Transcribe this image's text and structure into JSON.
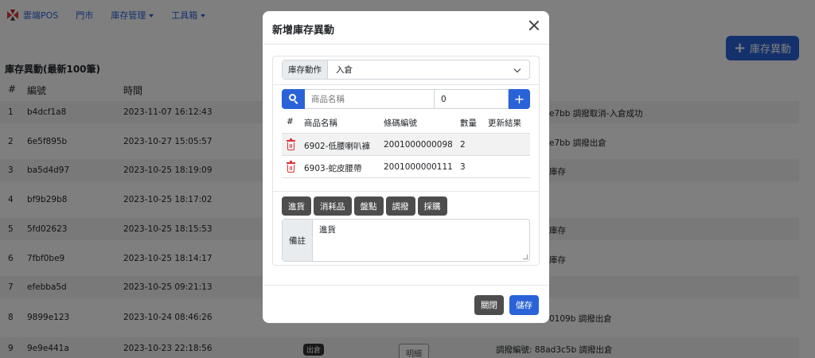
{
  "nav": {
    "brand": "雲端POS",
    "links": [
      "門市",
      "庫存管理",
      "工具箱"
    ]
  },
  "add_button_label": "庫存異動",
  "page_title": "庫存異動(最新100筆)",
  "table": {
    "headers": [
      "#",
      "編號",
      "時間"
    ],
    "rows": [
      {
        "num": "1",
        "id": "b4dcf1a8",
        "time": "2023-11-07 16:12:43",
        "note": "e7bb 調撥取消-入倉成功"
      },
      {
        "num": "2",
        "id": "6e5f895b",
        "time": "2023-10-27 15:05:57",
        "note": "e7bb 調撥出倉"
      },
      {
        "num": "3",
        "id": "ba5d4d97",
        "time": "2023-10-25 18:19:09",
        "note": "庫存"
      },
      {
        "num": "4",
        "id": "bf9b29b8",
        "time": "2023-10-25 18:17:02",
        "note": ""
      },
      {
        "num": "5",
        "id": "5fd02623",
        "time": "2023-10-25 18:15:53",
        "note": "庫存"
      },
      {
        "num": "6",
        "id": "7fbf0be9",
        "time": "2023-10-25 18:14:17",
        "note": "庫存"
      },
      {
        "num": "7",
        "id": "efebba5d",
        "time": "2023-10-25 09:21:13",
        "note": ""
      },
      {
        "num": "8",
        "id": "9899e123",
        "time": "2023-10-24 08:46:26",
        "note": "0109b 調撥出倉"
      },
      {
        "num": "9",
        "id": "9e9e441a",
        "time": "2023-10-23 22:18:56",
        "badge": "出倉",
        "detail": "明細",
        "note": "調撥編號: 88ad3c5b 調撥出倉"
      }
    ]
  },
  "modal": {
    "title": "新增庫存異動",
    "action_label": "庫存動作",
    "action_value": "入倉",
    "search_placeholder": "商品名稱",
    "qty_value": "0",
    "item_headers": [
      "#",
      "商品名稱",
      "條碼編號",
      "數量",
      "更新結果"
    ],
    "items": [
      {
        "name": "6902-低腰喇叭褲",
        "barcode": "2001000000098",
        "qty": "2",
        "result": ""
      },
      {
        "name": "6903-蛇皮腰帶",
        "barcode": "2001000000111",
        "qty": "3",
        "result": ""
      }
    ],
    "quick_buttons": [
      "進貨",
      "消耗品",
      "盤點",
      "調撥",
      "採購"
    ],
    "note_label": "備註",
    "note_value": "進貨",
    "close_label": "關閉",
    "save_label": "儲存"
  },
  "colors": {
    "primary": "#2a63d8",
    "secondary": "#4d4d4d",
    "danger": "#d33"
  }
}
